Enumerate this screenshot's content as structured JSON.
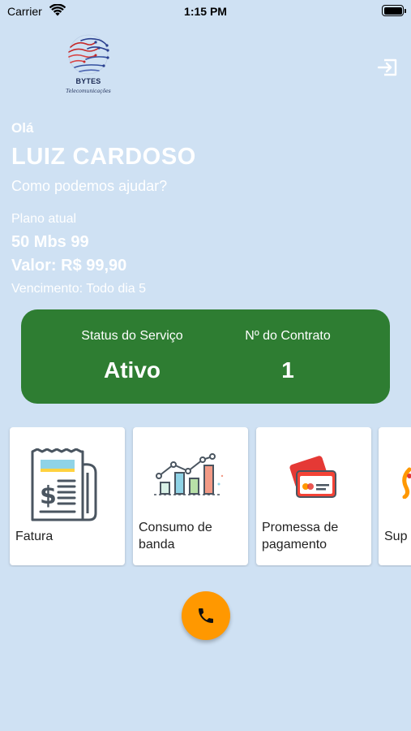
{
  "statusbar": {
    "carrier": "Carrier",
    "time": "1:15 PM"
  },
  "logo": {
    "name": "BYTES",
    "subtitle": "Telecomunicações"
  },
  "greeting": {
    "hello": "Olá",
    "name": "LUIZ CARDOSO",
    "prompt": "Como podemos ajudar?"
  },
  "plan": {
    "label": "Plano atual",
    "name": "50 Mbs 99",
    "value": "Valor: R$ 99,90",
    "due": "Vencimento: Todo dia 5"
  },
  "status_card": {
    "status_label": "Status do Serviço",
    "status_value": "Ativo",
    "contract_label": "Nº do Contrato",
    "contract_value": "1",
    "color": "#2e7d32"
  },
  "cards": [
    {
      "label_1": "Fatura",
      "icon": "invoice-icon"
    },
    {
      "label_1": "Consumo de",
      "label_2": "banda",
      "icon": "bandwidth-chart-icon"
    },
    {
      "label_1": "Promessa de",
      "label_2": "pagamento",
      "icon": "credit-card-icon"
    },
    {
      "label_1": "Sup",
      "icon": "support-icon"
    }
  ],
  "fab": {
    "icon": "phone-icon",
    "color": "#ff9800"
  },
  "colors": {
    "background": "#cfe1f3",
    "accent": "#ff9800",
    "green": "#2e7d32"
  }
}
